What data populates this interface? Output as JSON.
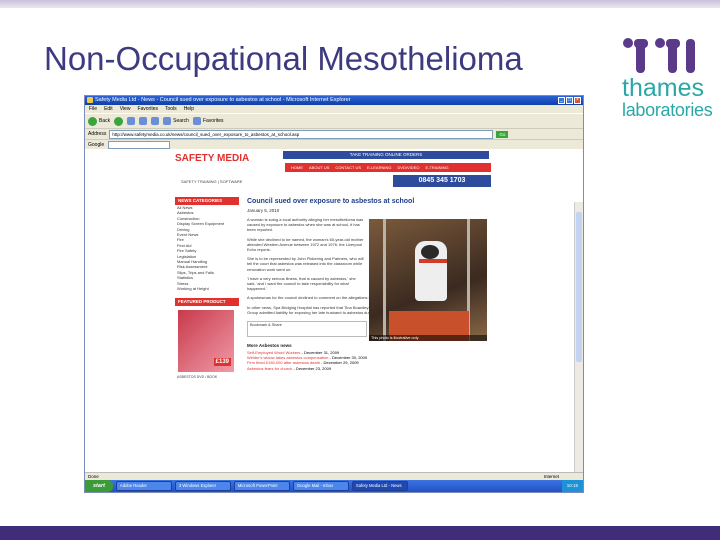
{
  "slide": {
    "title": "Non-Occupational Mesothelioma",
    "logo_line1": "thames",
    "logo_line2": "laboratories"
  },
  "browser": {
    "window_title": "Safety Media Ltd - News - Council sued over exposure to asbestos at school - Microsoft Internet Explorer",
    "menu": [
      "File",
      "Edit",
      "View",
      "Favorites",
      "Tools",
      "Help"
    ],
    "toolbar": {
      "back": "Back",
      "search": "Search",
      "favorites": "Favorites"
    },
    "address_label": "Address",
    "address_value": "http://www.safetymedia.co.uk/news/council_sued_over_exposure_to_asbestos_at_school.asp",
    "go_label": "Go",
    "google_label": "Google",
    "status_text": "Done",
    "status_zone": "Internet"
  },
  "site": {
    "brand": "SAFETY MEDIA",
    "tagline": "SAFETY TRAINING | SOFTWARE",
    "top_strip": "TAKE TRAINING ONLINE ORDERS",
    "nav": [
      "HOME",
      "ABOUT US",
      "CONTACT US",
      "E-LEARNING",
      "DVD/VIDEO",
      "E-TRAINING"
    ],
    "phone": "0845 345 1703",
    "categories_header": "NEWS CATEGORIES",
    "categories": [
      "All News",
      "Asbestos",
      "Construction",
      "Display Screen Equipment",
      "Driving",
      "Event News",
      "Fire",
      "First Aid",
      "Fire Safety",
      "Legislation",
      "Manual Handling",
      "Risk Assessment",
      "Slips, Trips and Falls",
      "Statistics",
      "Stress",
      "Working at Height"
    ],
    "featured_header": "FEATURED PRODUCT",
    "featured_price": "£139",
    "featured_caption": "ASBESTOS DVD / BOOK",
    "article": {
      "headline": "Council sued over exposure to asbestos at school",
      "date": "January 5, 2010",
      "p1": "A woman is suing a local authority alleging her mesothelioma was caused by exposure to asbestos when she was at school, it has been reported.",
      "p2": "While she declined to be named, the woman's 60-year-old mother attended Western Avenue between 1972 and 1976, the Liverpool Echo reports.",
      "p3": "She is to be represented by John Pickering and Partners, who will tell the court that asbestos was released into the classroom while renovation work went on.",
      "p4": "'I have a very serious illness, that is caused by asbestos,' she said, 'and I want the council to take responsibility for what happened.'",
      "p5": "A spokesman for the council declined to comment on the allegations but said it is unable to comment further at this time.",
      "p6": "In other news, Spa Bridging Hospital has reported that Tina Boardley has received £250,000 in compensation after the New Century Group admitted liability for exposing her late husband to asbestos dust.",
      "photo_caption": "This photo is illustrative only",
      "bookmark_label": "Bookmark & Share",
      "more_header": "More Asbestos news",
      "more_items": [
        {
          "link": "Self-Employed Wood Workers",
          "date": "- December 31, 2009"
        },
        {
          "link": "Welder's widow takes asbestos compensation",
          "date": "- December 30, 2009"
        },
        {
          "link": "Firm fined £180,000 after asbestos death",
          "date": "- December 29, 2009"
        },
        {
          "link": "Asbestos fears for church",
          "date": "- December 23, 2009"
        }
      ]
    }
  },
  "taskbar": {
    "start": "start",
    "tasks": [
      "Adobe Reader",
      "3 Windows Explorer",
      "Microsoft PowerPoint",
      "Google Mail - Inbox",
      "Safety Media Ltd - News"
    ],
    "clock": "10:15"
  }
}
